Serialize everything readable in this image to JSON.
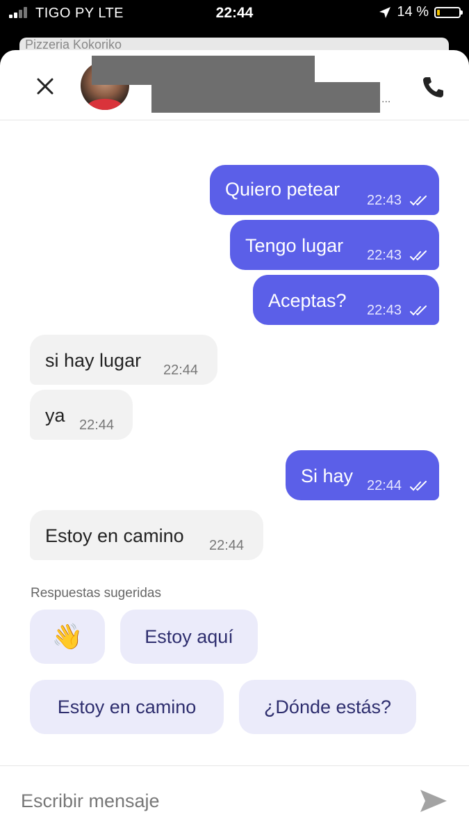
{
  "status_bar": {
    "carrier": "TIGO PY  LTE",
    "time": "22:44",
    "battery_percent": "14 %",
    "battery_level": 0.14
  },
  "map": {
    "place_label": "Pizzeria Kokoriko"
  },
  "header": {
    "contact_name_redacted": true,
    "ellipsis": "..."
  },
  "messages": [
    {
      "direction": "out",
      "text": "Quiero petear",
      "time": "22:43",
      "status": "read"
    },
    {
      "direction": "out",
      "text": "Tengo lugar",
      "time": "22:43",
      "status": "read"
    },
    {
      "direction": "out",
      "text": "Aceptas?",
      "time": "22:43",
      "status": "read"
    },
    {
      "direction": "in",
      "text": "si hay lugar",
      "time": "22:44"
    },
    {
      "direction": "in",
      "text": "ya",
      "time": "22:44"
    },
    {
      "direction": "out",
      "text": "Si hay",
      "time": "22:44",
      "status": "read"
    },
    {
      "direction": "in",
      "text": "Estoy en camino",
      "time": "22:44"
    }
  ],
  "suggestions": {
    "title": "Respuestas sugeridas",
    "items": [
      "👋",
      "Estoy aquí",
      "Estoy en camino",
      "¿Dónde estás?"
    ]
  },
  "composer": {
    "placeholder": "Escribir mensaje"
  },
  "colors": {
    "outgoing_bubble": "#5b5fe8",
    "incoming_bubble": "#f2f2f2",
    "suggestion_chip": "#ebebfa",
    "chip_text": "#2e2e6e"
  },
  "icons": {
    "close": "close-icon",
    "phone": "phone-icon",
    "send": "send-icon",
    "location": "location-arrow-icon",
    "read_ticks": "double-check-icon"
  }
}
